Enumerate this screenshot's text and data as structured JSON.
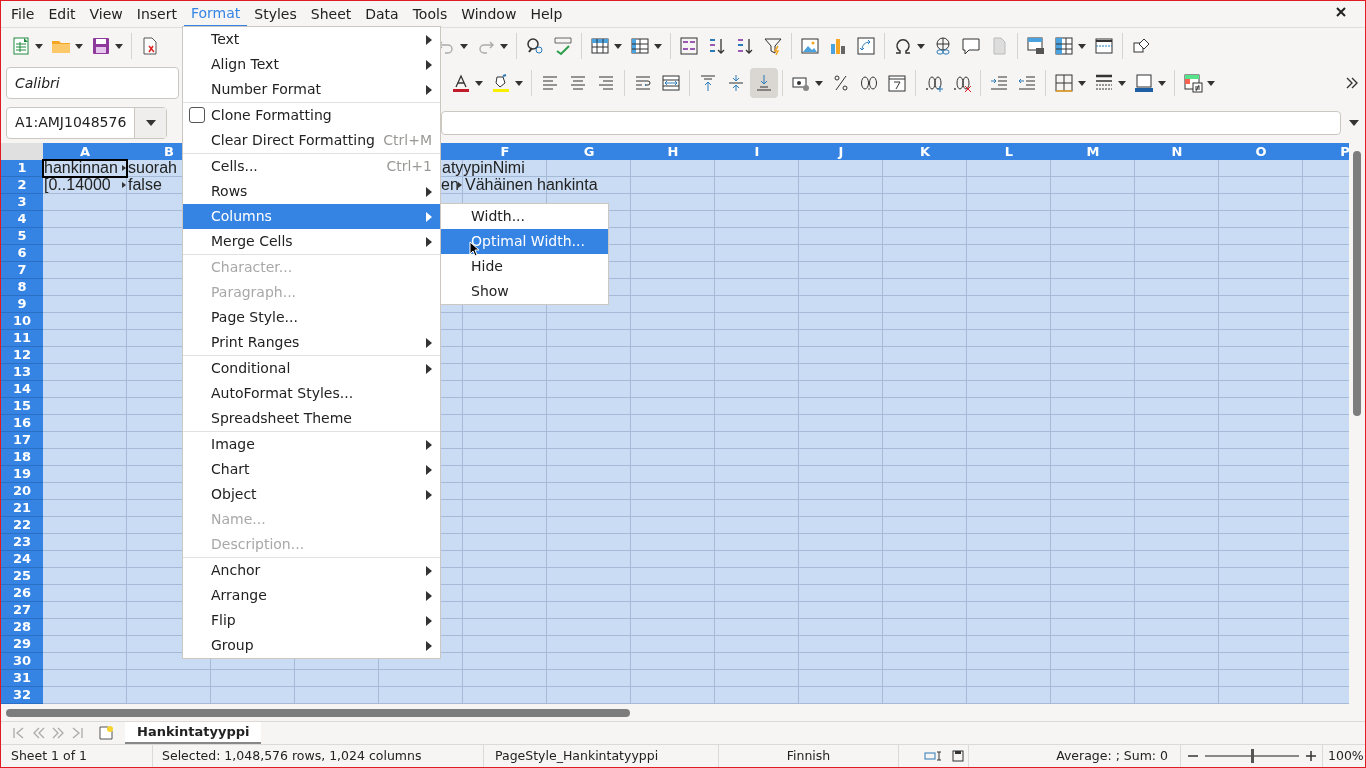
{
  "menubar": [
    {
      "label": "File",
      "selected": false
    },
    {
      "label": "Edit",
      "selected": false
    },
    {
      "label": "View",
      "selected": false
    },
    {
      "label": "Insert",
      "selected": false
    },
    {
      "label": "Format",
      "selected": true
    },
    {
      "label": "Styles",
      "selected": false
    },
    {
      "label": "Sheet",
      "selected": false
    },
    {
      "label": "Data",
      "selected": false
    },
    {
      "label": "Tools",
      "selected": false
    },
    {
      "label": "Window",
      "selected": false
    },
    {
      "label": "Help",
      "selected": false
    }
  ],
  "font_name": "Calibri",
  "name_box": "A1:AMJ1048576",
  "columns": [
    "A",
    "B"
  ],
  "columns_after_menu": [
    "F",
    "G",
    "H",
    "I",
    "J",
    "K",
    "L",
    "M",
    "N",
    "O",
    "P"
  ],
  "rows": [
    {
      "header": "1",
      "cells": [
        {
          "text": "hankinnan",
          "clipped": true,
          "active": true
        },
        {
          "text": "suorah",
          "clipped": false,
          "active": false
        }
      ],
      "cells_after_menu": [
        {
          "text": "atyypinNimi",
          "clipped": false,
          "active": false
        }
      ]
    },
    {
      "header": "2",
      "cells": [
        {
          "text": "[0..14000",
          "clipped": true,
          "active": false
        },
        {
          "text": "false",
          "clipped": false,
          "active": false
        }
      ],
      "cells_after_menu": [
        {
          "text": "en",
          "clipped": true,
          "active": false
        },
        {
          "text": "Vähäinen hankinta",
          "clipped": false,
          "active": false
        }
      ]
    },
    {
      "header": "3"
    },
    {
      "header": "4"
    },
    {
      "header": "5"
    },
    {
      "header": "6"
    },
    {
      "header": "7"
    },
    {
      "header": "8"
    },
    {
      "header": "9"
    },
    {
      "header": "10"
    },
    {
      "header": "11"
    },
    {
      "header": "12"
    },
    {
      "header": "13"
    },
    {
      "header": "14"
    },
    {
      "header": "15"
    },
    {
      "header": "16"
    },
    {
      "header": "17"
    },
    {
      "header": "18"
    },
    {
      "header": "19"
    },
    {
      "header": "20"
    },
    {
      "header": "21"
    },
    {
      "header": "22"
    },
    {
      "header": "23"
    },
    {
      "header": "24"
    },
    {
      "header": "25"
    },
    {
      "header": "26"
    },
    {
      "header": "27"
    },
    {
      "header": "28"
    },
    {
      "header": "29"
    },
    {
      "header": "30"
    },
    {
      "header": "31"
    },
    {
      "header": "32"
    }
  ],
  "format_menu": {
    "sections": [
      [
        {
          "label": "Text",
          "submenu": true,
          "disabled": false,
          "selected": false
        },
        {
          "label": "Align Text",
          "submenu": true,
          "disabled": false,
          "selected": false
        },
        {
          "label": "Number Format",
          "submenu": true,
          "disabled": false,
          "selected": false
        }
      ],
      [
        {
          "label": "Clone Formatting",
          "kind": "checkbox",
          "checked": false,
          "submenu": false,
          "disabled": false,
          "selected": false
        },
        {
          "label": "Clear Direct Formatting",
          "shortcut": "Ctrl+M",
          "submenu": false,
          "disabled": false,
          "selected": false
        }
      ],
      [
        {
          "label": "Cells...",
          "shortcut": "Ctrl+1",
          "submenu": false,
          "disabled": false,
          "selected": false
        },
        {
          "label": "Rows",
          "submenu": true,
          "disabled": false,
          "selected": false
        },
        {
          "label": "Columns",
          "submenu": true,
          "disabled": false,
          "selected": true
        },
        {
          "label": "Merge Cells",
          "submenu": true,
          "disabled": false,
          "selected": false
        }
      ],
      [
        {
          "label": "Character...",
          "submenu": false,
          "disabled": true,
          "selected": false
        },
        {
          "label": "Paragraph...",
          "submenu": false,
          "disabled": true,
          "selected": false
        },
        {
          "label": "Page Style...",
          "submenu": false,
          "disabled": false,
          "selected": false
        },
        {
          "label": "Print Ranges",
          "submenu": true,
          "disabled": false,
          "selected": false
        }
      ],
      [
        {
          "label": "Conditional",
          "submenu": true,
          "disabled": false,
          "selected": false
        },
        {
          "label": "AutoFormat Styles...",
          "submenu": false,
          "disabled": false,
          "selected": false
        },
        {
          "label": "Spreadsheet Theme",
          "submenu": false,
          "disabled": false,
          "selected": false
        }
      ],
      [
        {
          "label": "Image",
          "submenu": true,
          "disabled": false,
          "selected": false
        },
        {
          "label": "Chart",
          "submenu": true,
          "disabled": false,
          "selected": false
        },
        {
          "label": "Object",
          "submenu": true,
          "disabled": false,
          "selected": false
        },
        {
          "label": "Name...",
          "submenu": false,
          "disabled": true,
          "selected": false
        },
        {
          "label": "Description...",
          "submenu": false,
          "disabled": true,
          "selected": false
        }
      ],
      [
        {
          "label": "Anchor",
          "submenu": true,
          "disabled": false,
          "selected": false
        },
        {
          "label": "Arrange",
          "submenu": true,
          "disabled": false,
          "selected": false
        },
        {
          "label": "Flip",
          "submenu": true,
          "disabled": false,
          "selected": false
        },
        {
          "label": "Group",
          "submenu": true,
          "disabled": false,
          "selected": false
        }
      ]
    ]
  },
  "columns_submenu": [
    {
      "label": "Width...",
      "selected": false
    },
    {
      "label": "Optimal Width...",
      "selected": true
    },
    {
      "label": "Hide",
      "selected": false
    },
    {
      "label": "Show",
      "selected": false
    }
  ],
  "sheet_tabs": [
    {
      "label": "Hankintatyyppi",
      "selected": true
    }
  ],
  "status_bar": {
    "sheet": "Sheet 1 of 1",
    "selection": "Selected: 1,048,576 rows, 1,024 columns",
    "page_style": "PageStyle_Hankintatyyppi",
    "language": "Finnish",
    "summary": "Average: ; Sum: 0",
    "zoom": {
      "level": 0.5
    },
    "zoom_percent": "100%"
  }
}
